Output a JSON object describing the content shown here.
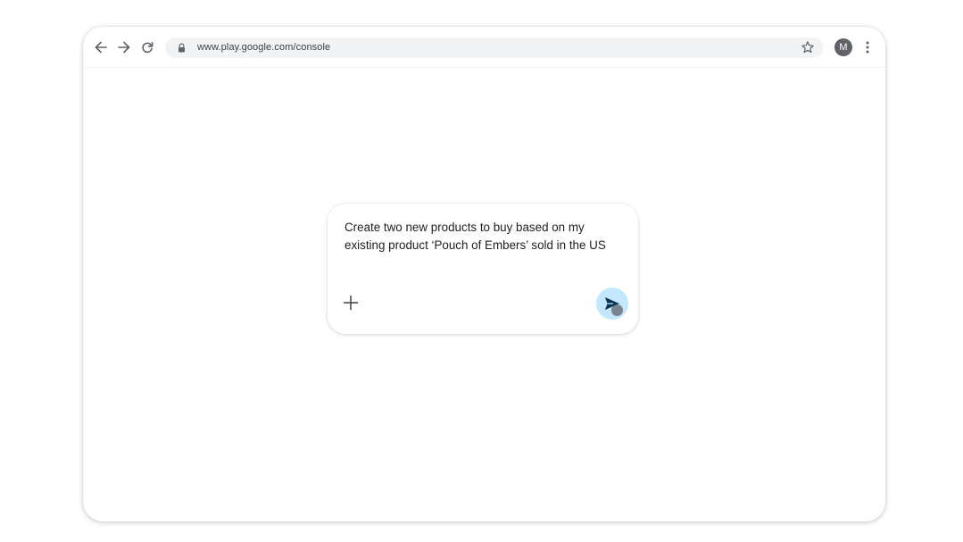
{
  "browser": {
    "url": "www.play.google.com/console",
    "profile_initial": "M",
    "icons": {
      "back": "arrow-back-icon",
      "forward": "arrow-forward-icon",
      "reload": "reload-icon",
      "lock": "lock-icon",
      "bookmark": "star-icon",
      "menu": "more-vert-icon"
    }
  },
  "prompt": {
    "text": "Create two new products to buy based on my existing product ‘Pouch of Embers’ sold in the US",
    "add_icon": "plus-icon",
    "send_icon": "send-icon"
  },
  "colors": {
    "send_button_bg": "#c2e7ff",
    "send_arrow": "#0b3654",
    "avatar_bg": "#5f6368",
    "omnibox_bg": "#f1f3f4"
  }
}
